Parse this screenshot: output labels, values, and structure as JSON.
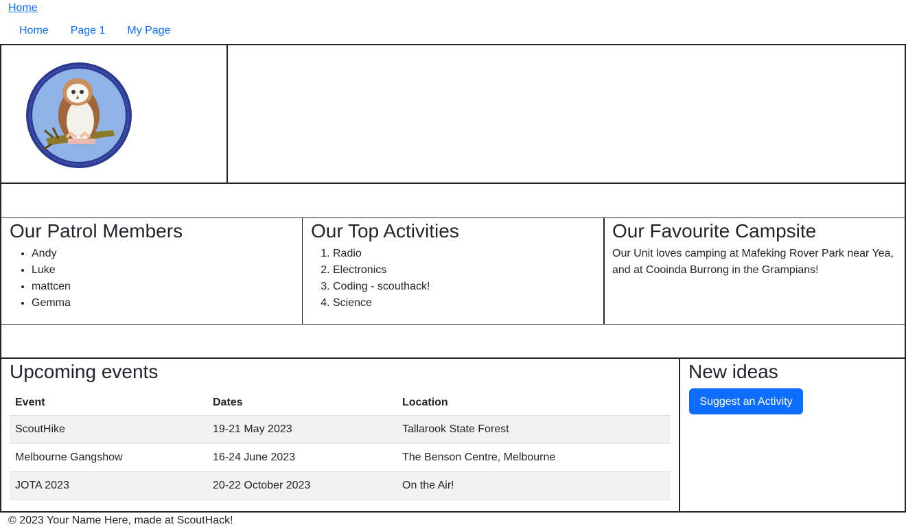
{
  "breadcrumb": {
    "home": "Home"
  },
  "nav": {
    "items": [
      "Home",
      "Page 1",
      "My Page"
    ]
  },
  "patrol": {
    "title": "Our Patrol Members",
    "members": [
      "Andy",
      "Luke",
      "mattcen",
      "Gemma"
    ]
  },
  "activities": {
    "title": "Our Top Activities",
    "items": [
      "Radio",
      "Electronics",
      "Coding - scouthack!",
      "Science"
    ]
  },
  "campsite": {
    "title": "Our Favourite Campsite",
    "text": "Our Unit loves camping at Mafeking Rover Park near Yea, and at Cooinda Burrong in the Grampians!"
  },
  "events": {
    "title": "Upcoming events",
    "headers": [
      "Event",
      "Dates",
      "Location"
    ],
    "rows": [
      [
        "ScoutHike",
        "19-21 May 2023",
        "Tallarook State Forest"
      ],
      [
        "Melbourne Gangshow",
        "16-24 June 2023",
        "The Benson Centre, Melbourne"
      ],
      [
        "JOTA 2023",
        "20-22 October 2023",
        "On the Air!"
      ]
    ]
  },
  "ideas": {
    "title": "New ideas",
    "button_label": "Suggest an Activity"
  },
  "footer": {
    "text": "© 2023 Your Name Here, made at ScoutHack!"
  },
  "colors": {
    "link": "#0d6efd",
    "button": "#0d6efd",
    "border": "#212529",
    "stripe": "#f2f2f2"
  },
  "icons": {
    "logo": "owl-badge-icon"
  }
}
